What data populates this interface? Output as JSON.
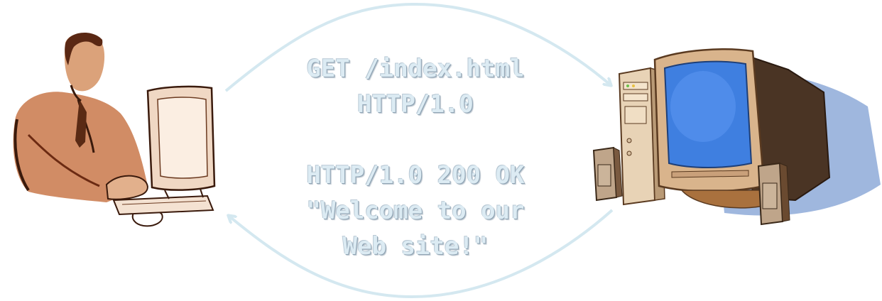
{
  "request": {
    "line1": "GET /index.html",
    "line2": "HTTP/1.0"
  },
  "response": {
    "line1": "HTTP/1.0 200 OK",
    "line2": "\"Welcome to our",
    "line3": "Web site!\""
  },
  "colors": {
    "arrow": "#d4e8f0",
    "text_fill": "#dcebf3",
    "monitor_screen": "#3f7fe0",
    "case_beige": "#e8d3b6",
    "figure_shading": "#b5663a",
    "shadow": "#9fb7de"
  },
  "icons": {
    "client": "person-at-computer-icon",
    "server": "desktop-computer-icon"
  }
}
